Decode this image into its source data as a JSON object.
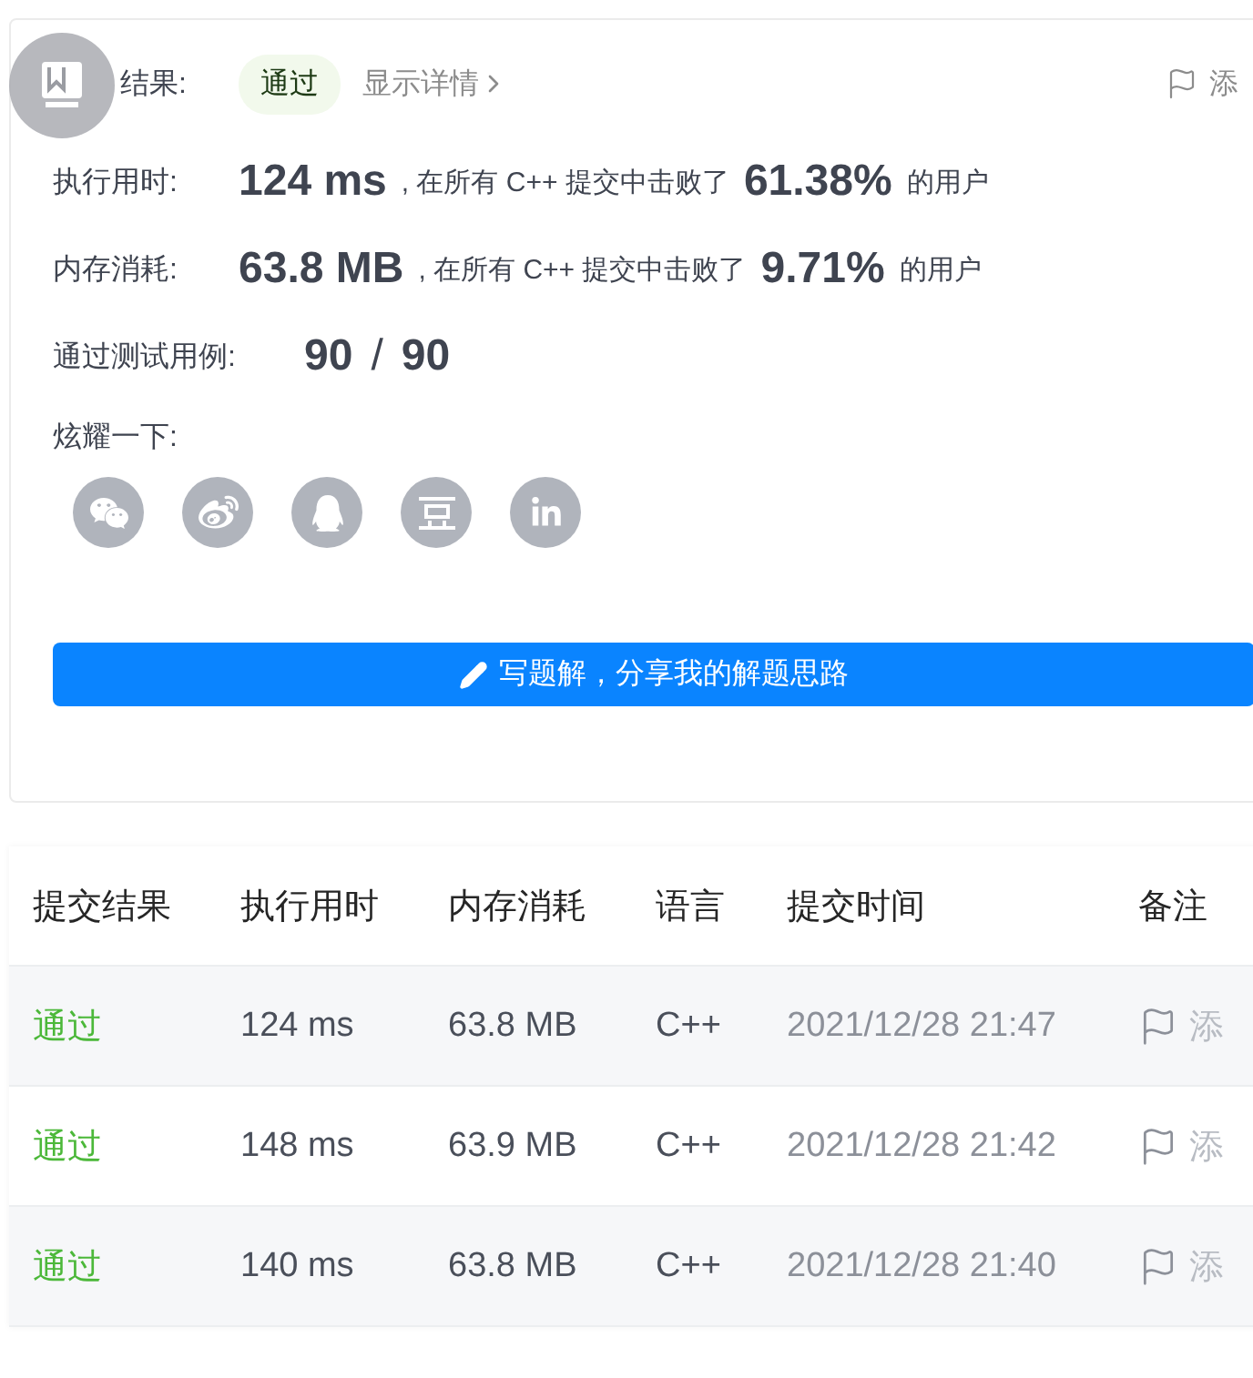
{
  "result": {
    "label": "结果:",
    "status": "通过",
    "details_link": "显示详情",
    "note_button": "添"
  },
  "stats": [
    {
      "label": "执行用时:",
      "value": "124 ms",
      "middle": ", 在所有 C++ 提交中击败了",
      "percent": "61.38%",
      "tail": "的用户"
    },
    {
      "label": "内存消耗:",
      "value": "63.8 MB",
      "middle": ", 在所有 C++ 提交中击败了",
      "percent": "9.71%",
      "tail": "的用户"
    }
  ],
  "tests": {
    "label": "通过测试用例:",
    "passed": "90",
    "separator": "/",
    "total": "90"
  },
  "share": {
    "label": "炫耀一下:"
  },
  "write_button": "写题解，分享我的解题思路",
  "table": {
    "columns": [
      "提交结果",
      "执行用时",
      "内存消耗",
      "语言",
      "提交时间",
      "备注"
    ],
    "rows": [
      {
        "status": "通过",
        "kind": "accepted",
        "time": "124 ms",
        "memory": "63.8 MB",
        "language": "C++",
        "submitted": "2021/12/28 21:47",
        "note": "添"
      },
      {
        "status": "通过",
        "kind": "accepted",
        "time": "148 ms",
        "memory": "63.9 MB",
        "language": "C++",
        "submitted": "2021/12/28 21:42",
        "note": "添"
      },
      {
        "status": "通过",
        "kind": "accepted",
        "time": "140 ms",
        "memory": "63.8 MB",
        "language": "C++",
        "submitted": "2021/12/28 21:40",
        "note": "添"
      }
    ]
  }
}
